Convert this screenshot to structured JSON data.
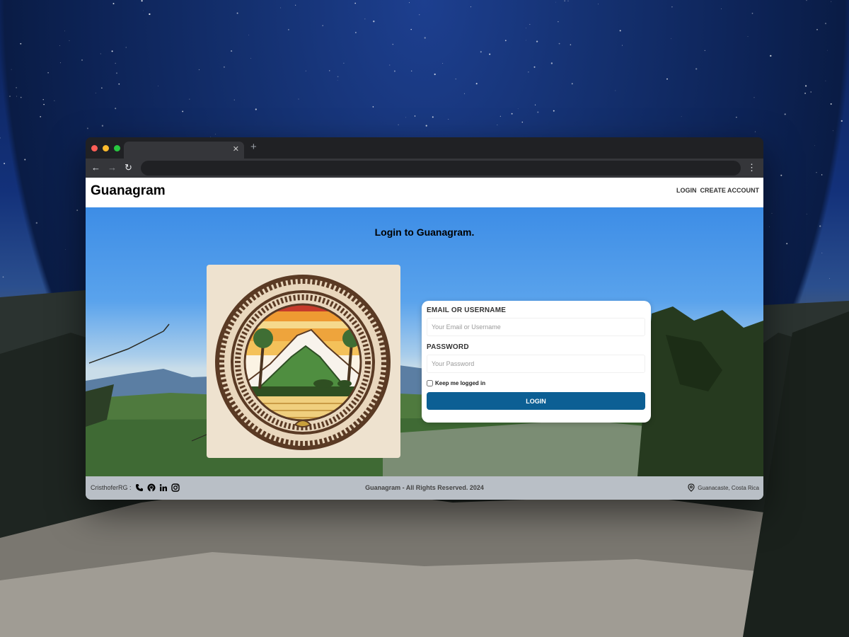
{
  "browser": {
    "tab_title": "",
    "url": ""
  },
  "nav": {
    "brand": "Guanagram",
    "links": [
      "LOGIN",
      "CREATE ACCOUNT"
    ]
  },
  "login": {
    "title": "Login to Guanagram.",
    "email_label": "EMAIL OR USERNAME",
    "email_placeholder": "Your Email or Username",
    "email_value": "",
    "password_label": "PASSWORD",
    "password_placeholder": "Your Password",
    "password_value": "",
    "remember_label": "Keep me logged in",
    "remember_checked": false,
    "submit_label": "LOGIN",
    "button_color": "#0c5f94"
  },
  "footer": {
    "author": "CristhoferRG :",
    "social_icons": [
      "phone-icon",
      "github-icon",
      "linkedin-icon",
      "instagram-icon"
    ],
    "copyright": "Guanagram - All Rights Reserved. 2024",
    "location": "Guanacaste, Costa Rica"
  }
}
